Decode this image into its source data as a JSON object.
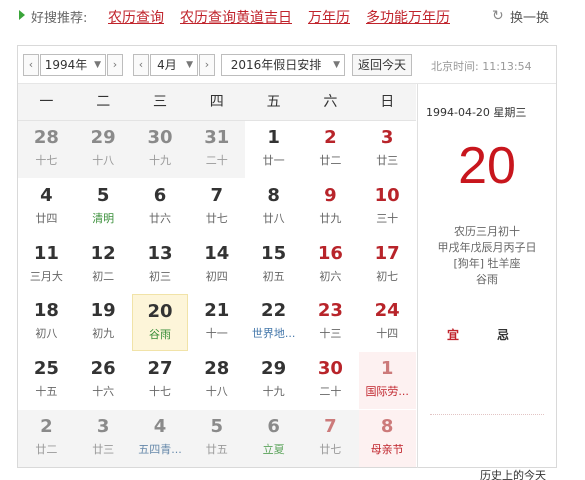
{
  "top": {
    "label": "好搜推荐:",
    "links": [
      "农历查询",
      "农历查询黄道吉日",
      "万年历",
      "多功能万年历"
    ],
    "swap": "换一换"
  },
  "controls": {
    "year": "1994年",
    "month": "4月",
    "holiday": "2016年假日安排",
    "today_btn": "返回今天",
    "time_label": "北京时间: 11:13:54"
  },
  "weekdays": [
    "一",
    "二",
    "三",
    "四",
    "五",
    "六",
    "日"
  ],
  "rows": [
    [
      {
        "d": "28",
        "l": "十七",
        "o": 1
      },
      {
        "d": "29",
        "l": "十八",
        "o": 1
      },
      {
        "d": "30",
        "l": "十九",
        "o": 1
      },
      {
        "d": "31",
        "l": "二十",
        "o": 1
      },
      {
        "d": "1",
        "l": "廿一"
      },
      {
        "d": "2",
        "l": "廿二"
      },
      {
        "d": "3",
        "l": "廿三"
      }
    ],
    [
      {
        "d": "4",
        "l": "廿四"
      },
      {
        "d": "5",
        "l": "清明",
        "c": "green"
      },
      {
        "d": "6",
        "l": "廿六"
      },
      {
        "d": "7",
        "l": "廿七"
      },
      {
        "d": "8",
        "l": "廿八"
      },
      {
        "d": "9",
        "l": "廿九"
      },
      {
        "d": "10",
        "l": "三十"
      }
    ],
    [
      {
        "d": "11",
        "l": "三月大"
      },
      {
        "d": "12",
        "l": "初二"
      },
      {
        "d": "13",
        "l": "初三"
      },
      {
        "d": "14",
        "l": "初四"
      },
      {
        "d": "15",
        "l": "初五"
      },
      {
        "d": "16",
        "l": "初六"
      },
      {
        "d": "17",
        "l": "初七"
      }
    ],
    [
      {
        "d": "18",
        "l": "初八"
      },
      {
        "d": "19",
        "l": "初九"
      },
      {
        "d": "20",
        "l": "谷雨",
        "c": "green",
        "t": 1
      },
      {
        "d": "21",
        "l": "十一"
      },
      {
        "d": "22",
        "l": "世界地...",
        "c": "blue"
      },
      {
        "d": "23",
        "l": "十三"
      },
      {
        "d": "24",
        "l": "十四"
      }
    ],
    [
      {
        "d": "25",
        "l": "十五"
      },
      {
        "d": "26",
        "l": "十六"
      },
      {
        "d": "27",
        "l": "十七"
      },
      {
        "d": "28",
        "l": "十八"
      },
      {
        "d": "29",
        "l": "十九"
      },
      {
        "d": "30",
        "l": "二十"
      },
      {
        "d": "1",
        "l": "国际劳...",
        "c": "red",
        "o": 1,
        "r": 1
      }
    ],
    [
      {
        "d": "2",
        "l": "廿二",
        "o": 1
      },
      {
        "d": "3",
        "l": "廿三",
        "o": 1
      },
      {
        "d": "4",
        "l": "五四青...",
        "c": "blue",
        "o": 1
      },
      {
        "d": "5",
        "l": "廿五",
        "o": 1
      },
      {
        "d": "6",
        "l": "立夏",
        "c": "green",
        "o": 1
      },
      {
        "d": "7",
        "l": "廿七",
        "o": 1
      },
      {
        "d": "8",
        "l": "母亲节",
        "c": "red",
        "o": 1,
        "r": 1
      }
    ]
  ],
  "side": {
    "date": "1994-04-20 星期三",
    "big_day": "20",
    "lunar1": "农历三月初十",
    "lunar2": "甲戌年戊辰月丙子日",
    "lunar3": "[狗年] 牡羊座",
    "lunar4": "谷雨",
    "yi": "宜",
    "ji": "忌",
    "history": "历史上的今天"
  }
}
